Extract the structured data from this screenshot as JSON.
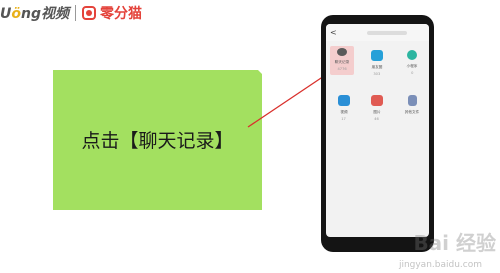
{
  "brand": {
    "logo_prefix": "U",
    "logo_o": "ö",
    "logo_suffix": "ng视频",
    "name": "零分猫"
  },
  "callout": {
    "text": "点击【聊天记录】"
  },
  "phone": {
    "back_label": "<",
    "tiles": [
      {
        "label": "聊天记录",
        "sub": "4776",
        "icon": "chat-bubbles-icon",
        "highlight": true
      },
      {
        "label": "朋友圈",
        "sub": "303",
        "icon": "moments-icon",
        "highlight": false
      },
      {
        "label": "小程序",
        "sub": "0",
        "icon": "mini-program-icon",
        "highlight": false
      },
      {
        "label": "视频",
        "sub": "17",
        "icon": "video-icon",
        "highlight": false
      },
      {
        "label": "图片",
        "sub": "46",
        "icon": "image-icon",
        "highlight": false
      },
      {
        "label": "其他文件",
        "sub": "",
        "icon": "file-icon",
        "highlight": false
      }
    ]
  },
  "watermark": {
    "baidu": "Bai 经验",
    "url": "jingyan.baidu.com"
  },
  "colors": {
    "callout_bg": "#a3e060",
    "pointer": "#d9302c",
    "brand_red": "#e4433b",
    "highlight": "#f4cdcd"
  }
}
